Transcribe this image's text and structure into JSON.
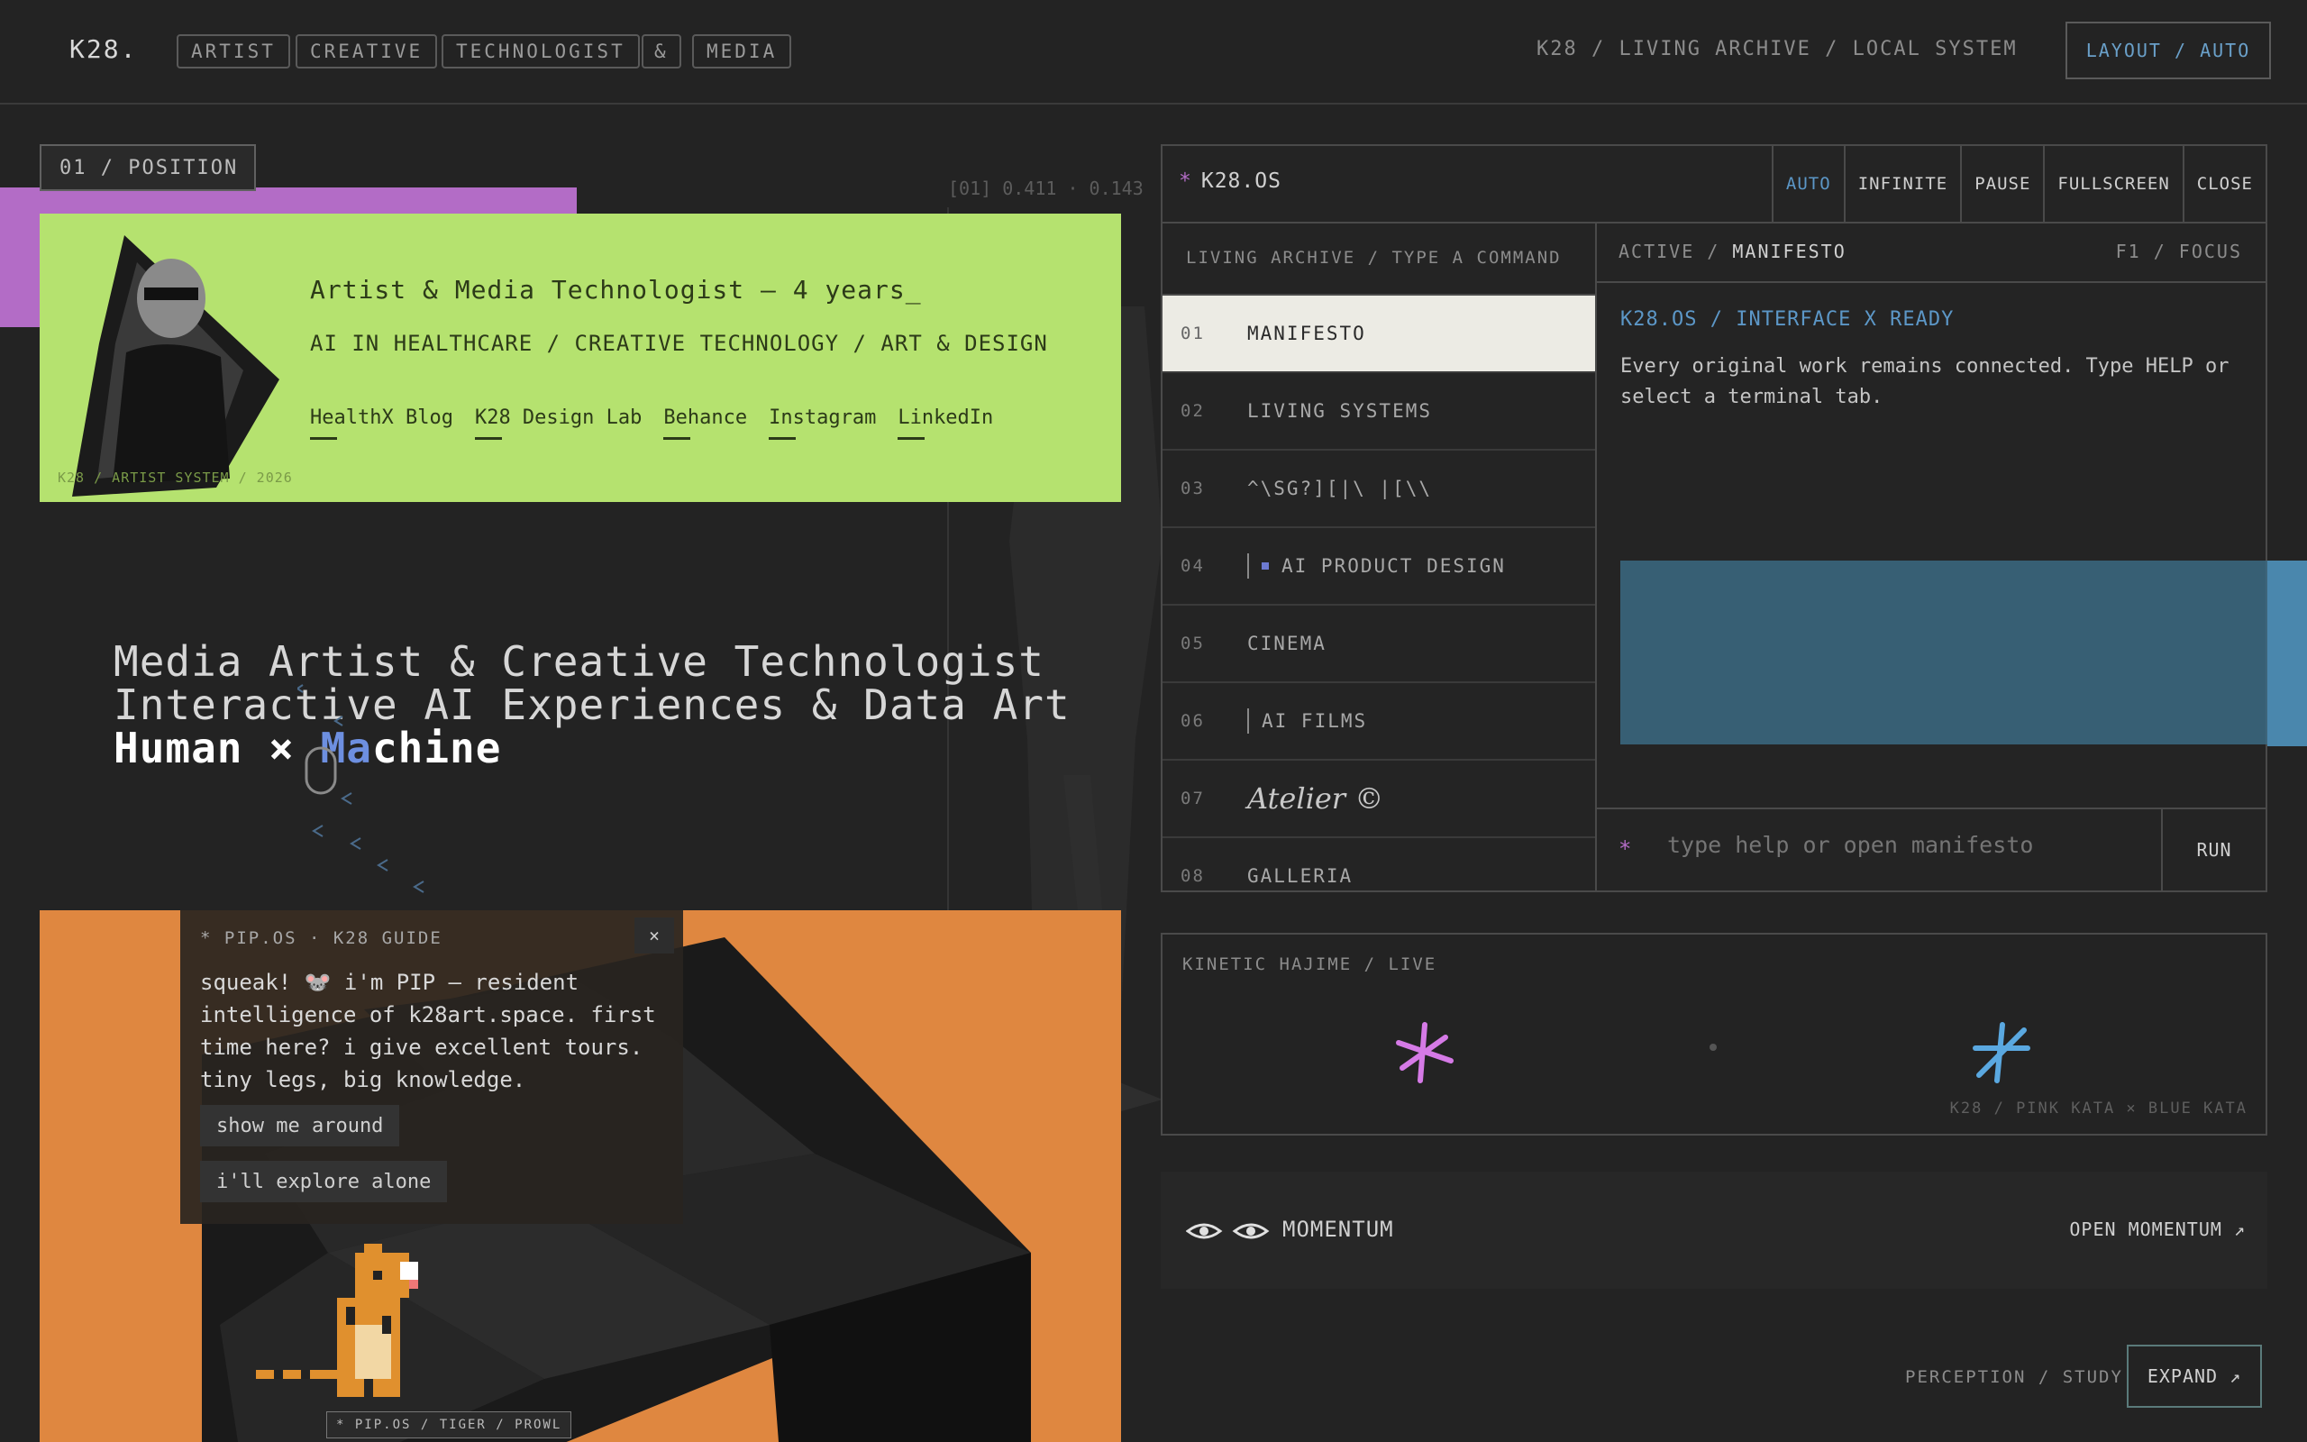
{
  "header": {
    "logo": "K28.",
    "tags": [
      "ARTIST",
      "CREATIVE",
      "TECHNOLOGIST",
      "&",
      "MEDIA"
    ],
    "breadcrumb": "K28 / LIVING ARCHIVE / LOCAL SYSTEM",
    "layout_button": "LAYOUT / AUTO"
  },
  "position_badge": "01 / POSITION",
  "coord_readout": "[01] 0.411 · 0.143",
  "profile_card": {
    "title": "Artist & Media Technologist — 4 years_",
    "subtitle": "AI IN HEALTHCARE / CREATIVE TECHNOLOGY / ART & DESIGN",
    "links": [
      "HealthX Blog",
      "K28 Design Lab",
      "Behance",
      "Instagram",
      "LinkedIn"
    ],
    "footer": "K28 / ARTIST SYSTEM / 2026"
  },
  "headline": {
    "line1": "Media Artist & Creative Technologist",
    "line2": "Interactive AI Experiences & Data Art",
    "line3a": "Human × ",
    "line3b": "Ma",
    "line3c": "chine"
  },
  "pip": {
    "title": "* PIP.OS · K28 GUIDE",
    "close": "×",
    "message": "squeak! 🐭 i'm PIP — resident intelligence of k28art.space. first time here? i give excellent tours. tiny legs, big knowledge.",
    "btn_tour": "show me around",
    "btn_alone": "i'll explore alone",
    "badge": "* PIP.OS / TIGER / PROWL"
  },
  "terminal": {
    "title": "K28.OS",
    "tabs": [
      "AUTO",
      "INFINITE",
      "PAUSE",
      "FULLSCREEN",
      "CLOSE"
    ],
    "sidebar_header": "LIVING ARCHIVE / TYPE A COMMAND",
    "items": [
      {
        "num": "01",
        "label": "MANIFESTO"
      },
      {
        "num": "02",
        "label": "LIVING SYSTEMS"
      },
      {
        "num": "03",
        "label": "^\\SG?][|\\ |[\\\\"
      },
      {
        "num": "04",
        "label": "AI PRODUCT DESIGN"
      },
      {
        "num": "05",
        "label": "CINEMA"
      },
      {
        "num": "06",
        "label": "AI FILMS"
      },
      {
        "num": "07",
        "label": "Atelier ©"
      },
      {
        "num": "08",
        "label": "GALLERIA"
      }
    ],
    "active_prefix": "ACTIVE / ",
    "active_name": "MANIFESTO",
    "focus": "F1 / FOCUS",
    "ready": "K28.OS / INTERFACE X READY",
    "body": "Every original work remains connected. Type HELP or select a terminal tab.",
    "input_placeholder": "type help or open manifesto",
    "run": "RUN"
  },
  "kinetic": {
    "label": "KINETIC HAJIME / LIVE",
    "caption": "K28 / PINK KATA × BLUE KATA",
    "colors": {
      "pink": "#d57ae6",
      "blue": "#5aa8e0"
    }
  },
  "momentum": {
    "title": "MOMENTUM",
    "open": "OPEN MOMENTUM ↗"
  },
  "footer": {
    "perception": "PERCEPTION / STUDY",
    "expand": "EXPAND ↗"
  },
  "colors": {
    "background": "#232323",
    "green": "#b5e26f",
    "purple": "#b36cc6",
    "orange": "#df8740",
    "accent_blue": "#5c97c7"
  }
}
